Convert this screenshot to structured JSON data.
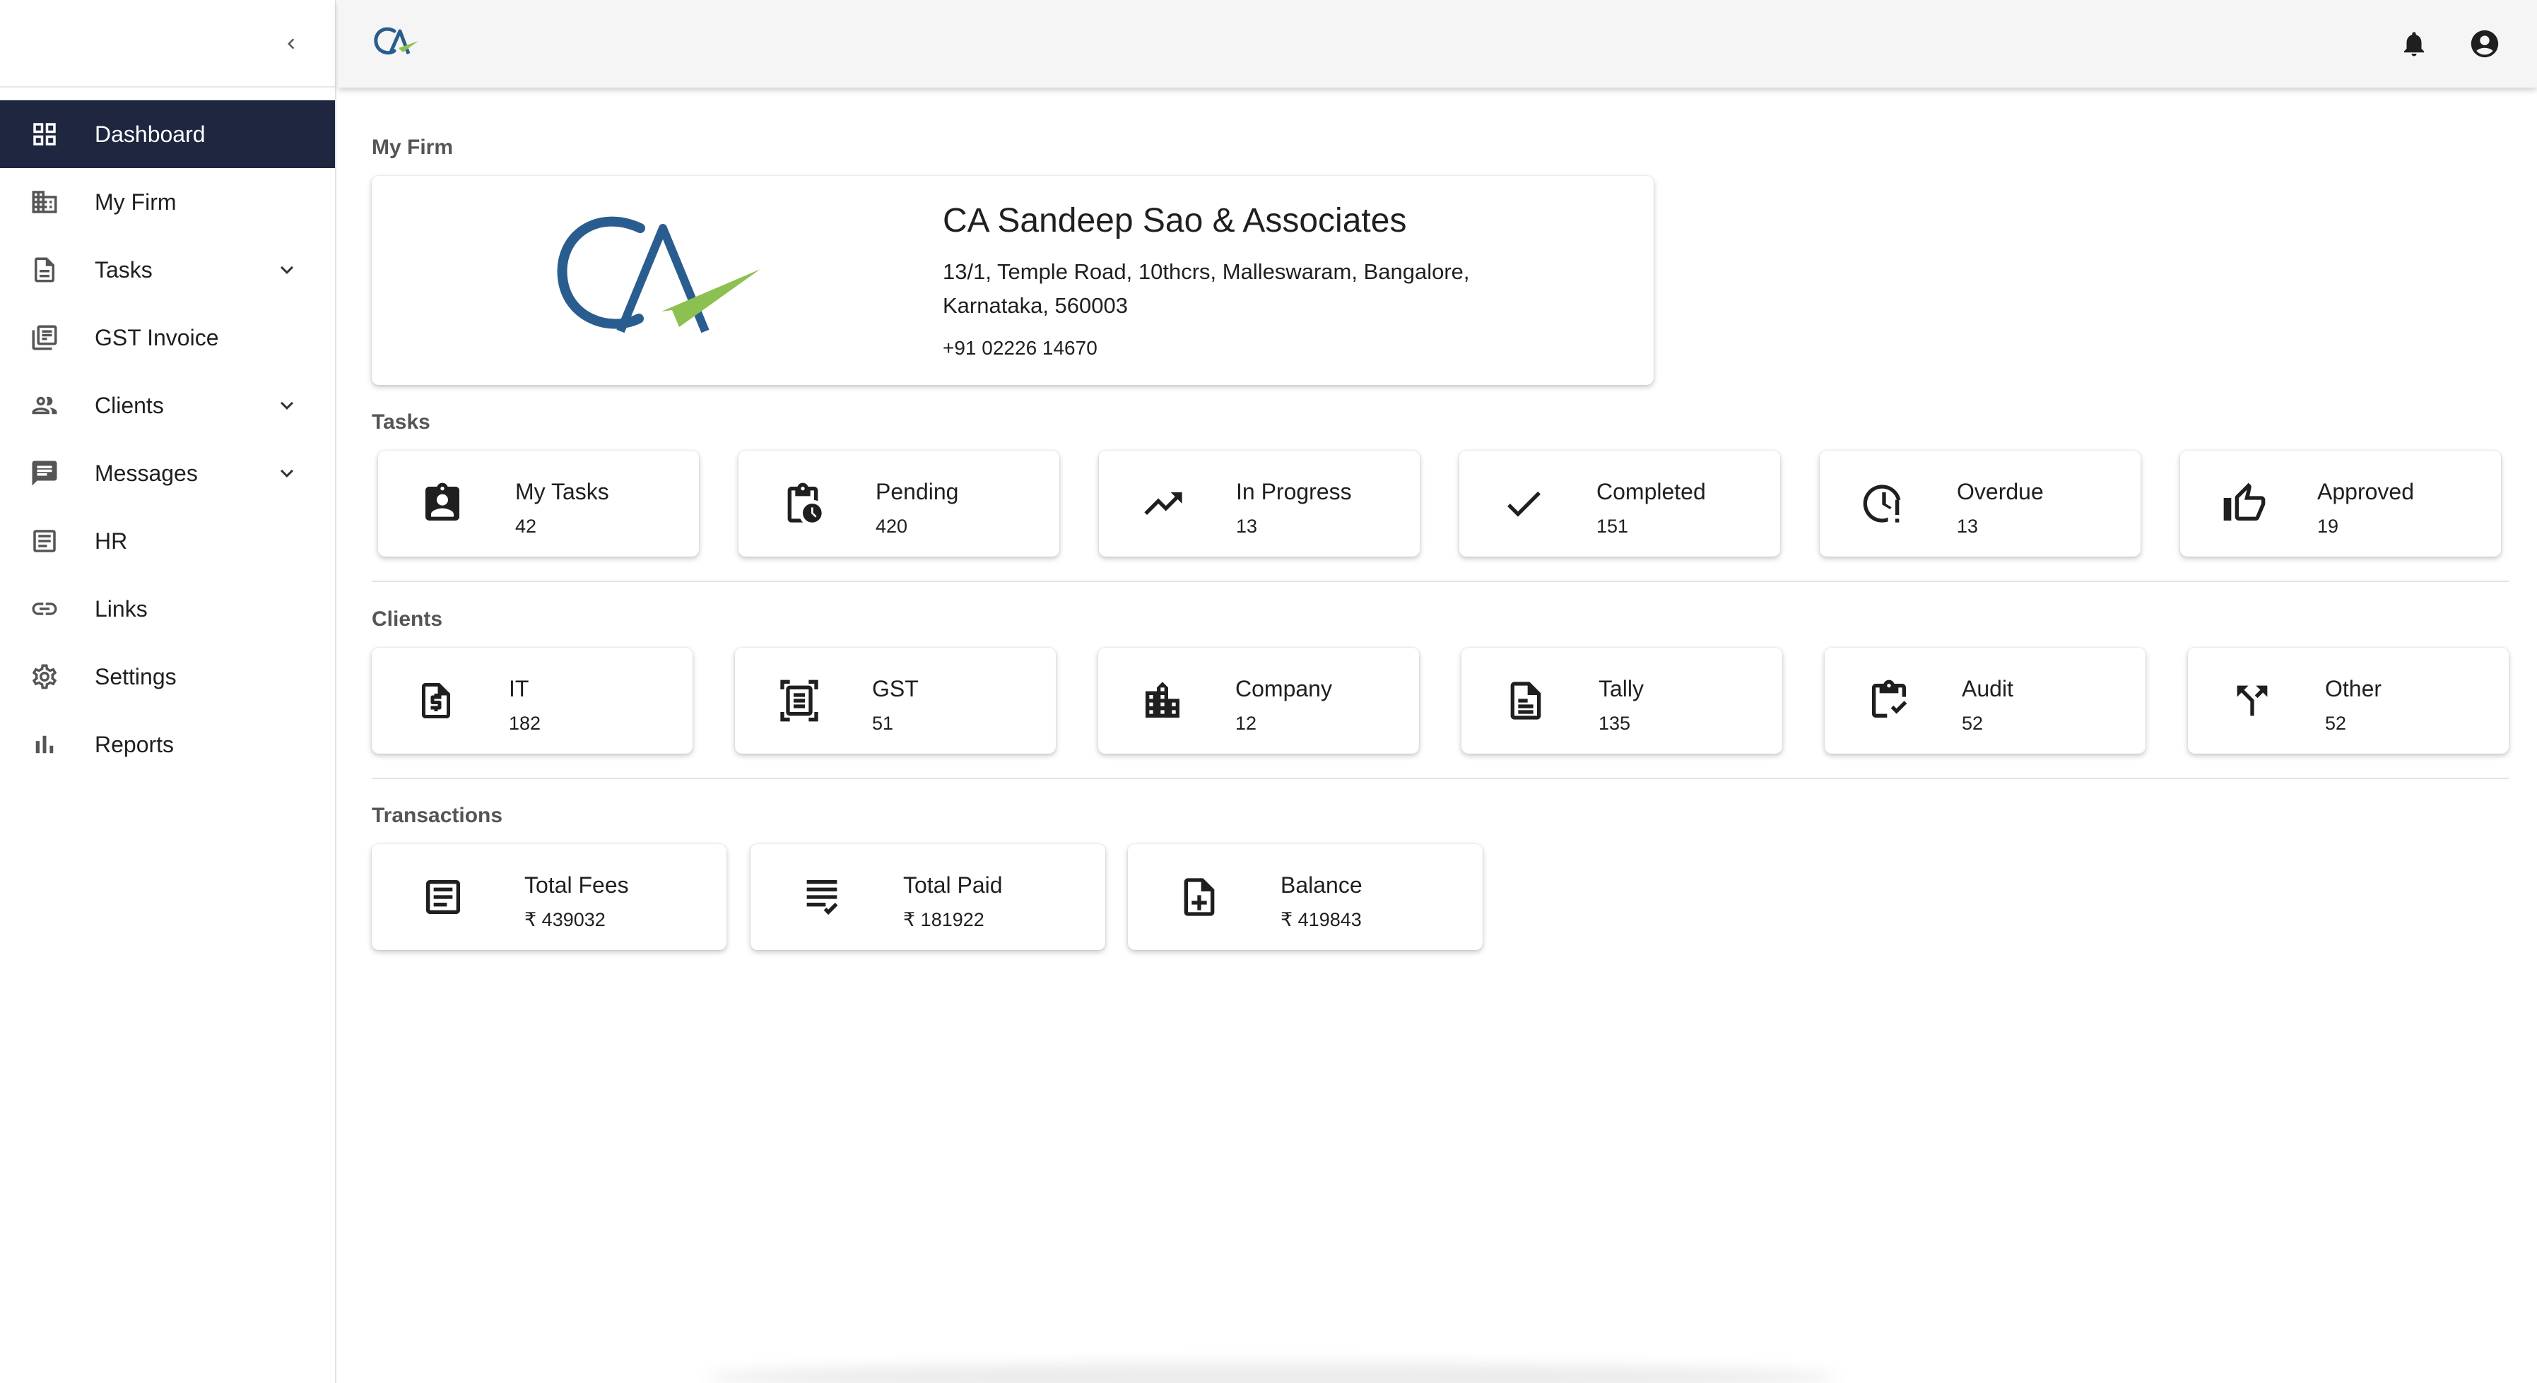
{
  "sidebar": {
    "items": [
      {
        "label": "Dashboard",
        "icon": "dashboard-icon",
        "active": true
      },
      {
        "label": "My Firm",
        "icon": "building-icon"
      },
      {
        "label": "Tasks",
        "icon": "document-icon",
        "expandable": true
      },
      {
        "label": "GST Invoice",
        "icon": "invoice-icon"
      },
      {
        "label": "Clients",
        "icon": "people-icon",
        "expandable": true
      },
      {
        "label": "Messages",
        "icon": "message-icon",
        "expandable": true
      },
      {
        "label": "HR",
        "icon": "hr-doc-icon"
      },
      {
        "label": "Links",
        "icon": "link-icon"
      },
      {
        "label": "Settings",
        "icon": "gear-icon"
      },
      {
        "label": "Reports",
        "icon": "bar-chart-icon"
      }
    ]
  },
  "header": {
    "logo_text": "CA"
  },
  "firm": {
    "section_title": "My Firm",
    "name": "CA Sandeep Sao & Associates",
    "address": "13/1, Temple Road, 10thcrs, Malleswaram, Bangalore, Karnataka, 560003",
    "phone": "+91 02226 14670"
  },
  "tasks": {
    "section_title": "Tasks",
    "cards": [
      {
        "label": "My Tasks",
        "value": "42",
        "icon": "assignment-ind-icon"
      },
      {
        "label": "Pending",
        "value": "420",
        "icon": "pending-actions-icon"
      },
      {
        "label": "In Progress",
        "value": "13",
        "icon": "trending-up-icon"
      },
      {
        "label": "Completed",
        "value": "151",
        "icon": "check-icon"
      },
      {
        "label": "Overdue",
        "value": "13",
        "icon": "overdue-icon"
      },
      {
        "label": "Approved",
        "value": "19",
        "icon": "thumb-up-icon"
      }
    ]
  },
  "clients": {
    "section_title": "Clients",
    "cards": [
      {
        "label": "IT",
        "value": "182",
        "icon": "money-doc-icon"
      },
      {
        "label": "GST",
        "value": "51",
        "icon": "document-scanner-icon"
      },
      {
        "label": "Company",
        "value": "12",
        "icon": "company-building-icon"
      },
      {
        "label": "Tally",
        "value": "135",
        "icon": "article-icon"
      },
      {
        "label": "Audit",
        "value": "52",
        "icon": "clipboard-check-icon"
      },
      {
        "label": "Other",
        "value": "52",
        "icon": "merge-arrows-icon"
      }
    ]
  },
  "transactions": {
    "section_title": "Transactions",
    "cards": [
      {
        "label": "Total Fees",
        "value": "₹ 439032",
        "icon": "receipt-icon"
      },
      {
        "label": "Total Paid",
        "value": "₹ 181922",
        "icon": "list-check-icon"
      },
      {
        "label": "Balance",
        "value": "₹ 419843",
        "icon": "note-add-icon"
      }
    ]
  },
  "colors": {
    "sidebar_active_bg": "#1e2640",
    "logo_blue": "#2a5d8f",
    "logo_green": "#8cc152"
  }
}
